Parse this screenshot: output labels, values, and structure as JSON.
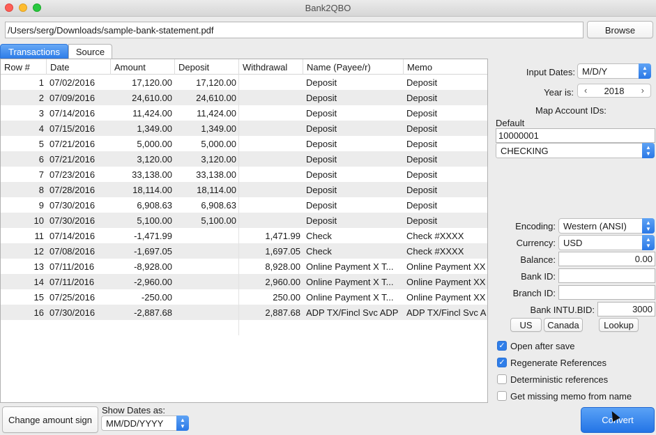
{
  "window": {
    "title": "Bank2QBO"
  },
  "file": {
    "path": "/Users/serg/Downloads/sample-bank-statement.pdf",
    "browse_label": "Browse"
  },
  "tabs": [
    {
      "label": "Transactions"
    },
    {
      "label": "Source"
    }
  ],
  "table": {
    "columns": [
      "Row #",
      "Date",
      "Amount",
      "Deposit",
      "Withdrawal",
      "Name (Payee/r)",
      "Memo"
    ],
    "rows": [
      {
        "n": "1",
        "date": "07/02/2016",
        "amount": "17,120.00",
        "deposit": "17,120.00",
        "withdrawal": "",
        "name": "Deposit",
        "memo": "Deposit"
      },
      {
        "n": "2",
        "date": "07/09/2016",
        "amount": "24,610.00",
        "deposit": "24,610.00",
        "withdrawal": "",
        "name": "Deposit",
        "memo": "Deposit"
      },
      {
        "n": "3",
        "date": "07/14/2016",
        "amount": "11,424.00",
        "deposit": "11,424.00",
        "withdrawal": "",
        "name": "Deposit",
        "memo": "Deposit"
      },
      {
        "n": "4",
        "date": "07/15/2016",
        "amount": "1,349.00",
        "deposit": "1,349.00",
        "withdrawal": "",
        "name": "Deposit",
        "memo": "Deposit"
      },
      {
        "n": "5",
        "date": "07/21/2016",
        "amount": "5,000.00",
        "deposit": "5,000.00",
        "withdrawal": "",
        "name": "Deposit",
        "memo": "Deposit"
      },
      {
        "n": "6",
        "date": "07/21/2016",
        "amount": "3,120.00",
        "deposit": "3,120.00",
        "withdrawal": "",
        "name": "Deposit",
        "memo": "Deposit"
      },
      {
        "n": "7",
        "date": "07/23/2016",
        "amount": "33,138.00",
        "deposit": "33,138.00",
        "withdrawal": "",
        "name": "Deposit",
        "memo": "Deposit"
      },
      {
        "n": "8",
        "date": "07/28/2016",
        "amount": "18,114.00",
        "deposit": "18,114.00",
        "withdrawal": "",
        "name": "Deposit",
        "memo": "Deposit"
      },
      {
        "n": "9",
        "date": "07/30/2016",
        "amount": "6,908.63",
        "deposit": "6,908.63",
        "withdrawal": "",
        "name": "Deposit",
        "memo": "Deposit"
      },
      {
        "n": "10",
        "date": "07/30/2016",
        "amount": "5,100.00",
        "deposit": "5,100.00",
        "withdrawal": "",
        "name": "Deposit",
        "memo": "Deposit"
      },
      {
        "n": "11",
        "date": "07/14/2016",
        "amount": "-1,471.99",
        "deposit": "",
        "withdrawal": "1,471.99",
        "name": "Check",
        "memo": "Check #XXXX"
      },
      {
        "n": "12",
        "date": "07/08/2016",
        "amount": "-1,697.05",
        "deposit": "",
        "withdrawal": "1,697.05",
        "name": "Check",
        "memo": "Check #XXXX"
      },
      {
        "n": "13",
        "date": "07/11/2016",
        "amount": "-8,928.00",
        "deposit": "",
        "withdrawal": "8,928.00",
        "name": "Online Payment X T...",
        "memo": "Online Payment XX"
      },
      {
        "n": "14",
        "date": "07/11/2016",
        "amount": "-2,960.00",
        "deposit": "",
        "withdrawal": "2,960.00",
        "name": "Online Payment X T...",
        "memo": "Online Payment XX"
      },
      {
        "n": "15",
        "date": "07/25/2016",
        "amount": "-250.00",
        "deposit": "",
        "withdrawal": "250.00",
        "name": "Online Payment X T...",
        "memo": "Online Payment XX"
      },
      {
        "n": "16",
        "date": "07/30/2016",
        "amount": "-2,887.68",
        "deposit": "",
        "withdrawal": "2,887.68",
        "name": "ADP TX/Fincl Svc ADP",
        "memo": "ADP TX/Fincl Svc A"
      }
    ]
  },
  "settings": {
    "input_dates_label": "Input Dates:",
    "input_dates_value": "M/D/Y",
    "year_label": "Year is:",
    "year_value": "2018",
    "map_label": "Map Account IDs:",
    "default_label": "Default",
    "account_id": "10000001",
    "account_type": "CHECKING",
    "encoding_label": "Encoding:",
    "encoding_value": "Western (ANSI)",
    "currency_label": "Currency:",
    "currency_value": "USD",
    "balance_label": "Balance:",
    "balance_value": "0.00",
    "bankid_label": "Bank ID:",
    "bankid_value": "",
    "branchid_label": "Branch ID:",
    "branchid_value": "",
    "intubid_label": "Bank INTU.BID:",
    "intubid_value": "3000",
    "us_label": "US",
    "canada_label": "Canada",
    "lookup_label": "Lookup",
    "checkboxes": [
      {
        "label": "Open after save",
        "checked": true
      },
      {
        "label": "Regenerate References",
        "checked": true
      },
      {
        "label": "Deterministic references",
        "checked": false
      },
      {
        "label": "Get missing memo from name",
        "checked": false
      }
    ]
  },
  "bottom": {
    "change_sign_label": "Change amount sign",
    "show_dates_label": "Show Dates as:",
    "show_dates_value": "MM/DD/YYYY",
    "convert_label": "Convert"
  }
}
